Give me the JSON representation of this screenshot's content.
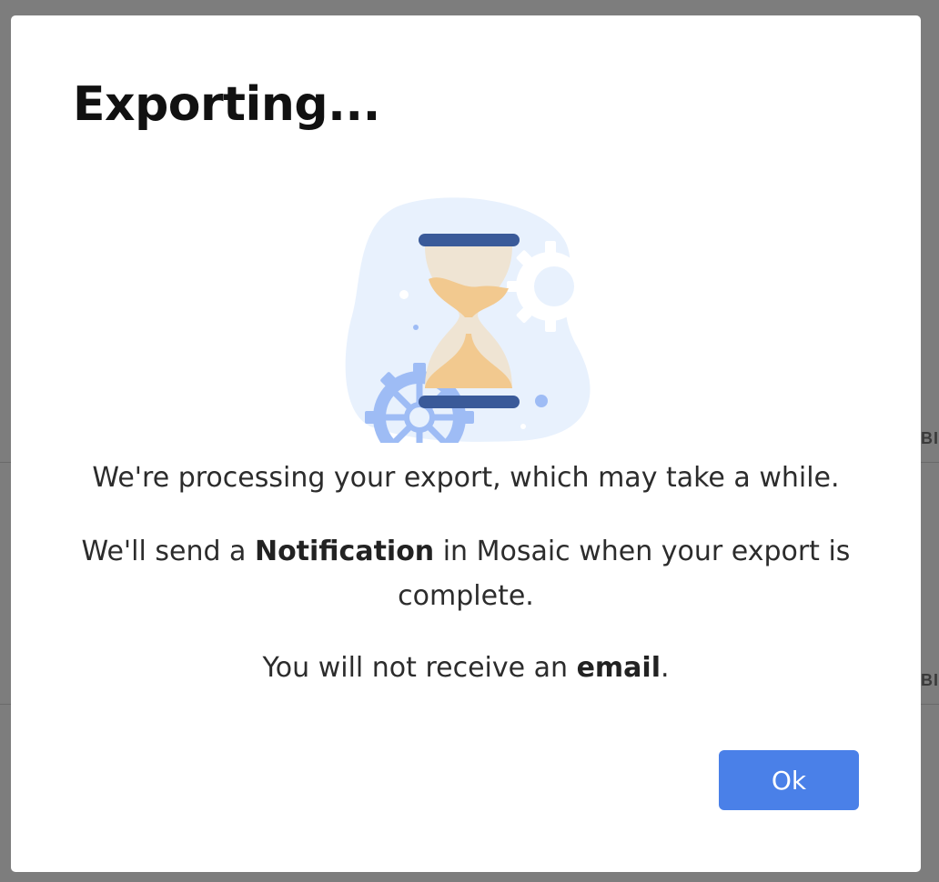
{
  "background": {
    "peek_text_1": "BIL",
    "peek_text_2": "BIL"
  },
  "dialog": {
    "title": "Exporting...",
    "illustration_icon": "hourglass-with-gears",
    "message1": "We're processing your export, which may take a while.",
    "message2_prefix": "We'll send a ",
    "message2_bold": "Notification",
    "message2_suffix": " in Mosaic when your export is complete.",
    "message3_prefix": "You will not receive an ",
    "message3_bold": "email",
    "message3_suffix": ".",
    "ok_label": "Ok"
  },
  "colors": {
    "accent": "#4a80e8",
    "hourglass_frame": "#3a5a99",
    "sand": "#f2c98f",
    "gear": "#9ebcf5",
    "blob": "#e8f1fd"
  }
}
